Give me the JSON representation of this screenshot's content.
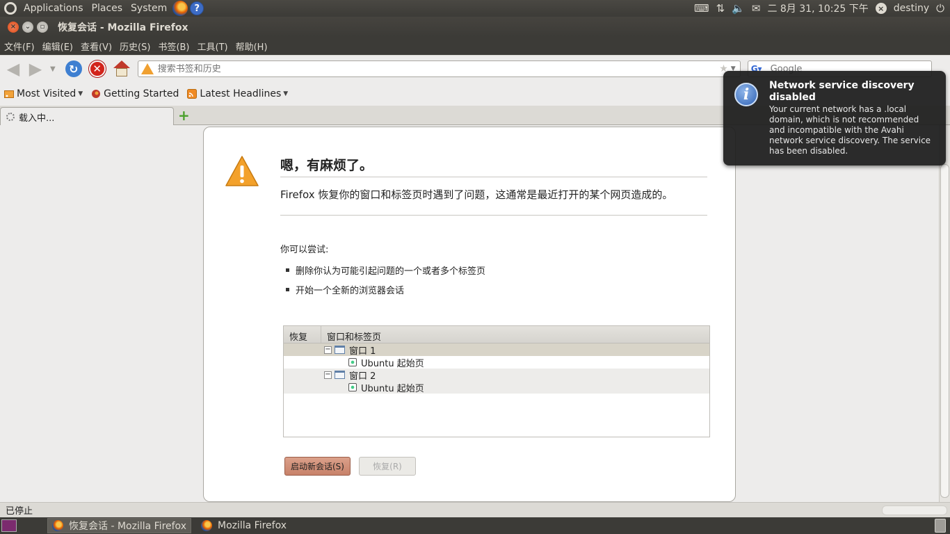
{
  "top_panel": {
    "menus": [
      "Applications",
      "Places",
      "System"
    ],
    "help_glyph": "?",
    "clock": "二 8月 31, 10:25 下午",
    "user": "destiny"
  },
  "window": {
    "title": "恢复会话 - Mozilla Firefox"
  },
  "menubar": {
    "items": [
      "文件(F)",
      "编辑(E)",
      "查看(V)",
      "历史(S)",
      "书签(B)",
      "工具(T)",
      "帮助(H)"
    ]
  },
  "navbar": {
    "url_placeholder": "搜索书签和历史",
    "search_placeholder": "Google"
  },
  "bookmarks": {
    "items": [
      "Most Visited",
      "Getting Started",
      "Latest Headlines"
    ]
  },
  "tabs": {
    "active_label": "载入中..."
  },
  "error_page": {
    "title": "嗯，有麻烦了。",
    "description": "Firefox 恢复你的窗口和标签页时遇到了问题，这通常是最近打开的某个网页造成的。",
    "try_label": "你可以尝试:",
    "suggestions": [
      "删除你认为可能引起问题的一个或者多个标签页",
      "开始一个全新的浏览器会话"
    ],
    "tree": {
      "col_restore": "恢复",
      "col_windows": "窗口和标签页",
      "rows": [
        {
          "label": "窗口 1",
          "type": "window",
          "toggle": "−"
        },
        {
          "label": "Ubuntu 起始页",
          "type": "page"
        },
        {
          "label": "窗口 2",
          "type": "window",
          "toggle": "−"
        },
        {
          "label": "Ubuntu 起始页",
          "type": "page"
        }
      ]
    },
    "btn_new_session": "启动新会话(S)",
    "btn_restore": "恢复(R)"
  },
  "statusbar": {
    "text": "已停止"
  },
  "taskbar": {
    "tasks": [
      "恢复会话 - Mozilla Firefox",
      "Mozilla Firefox"
    ]
  },
  "notification": {
    "title": "Network service discovery disabled",
    "body": "Your current network has a .local domain, which is not recommended and incompatible with the Avahi network service discovery. The service has been disabled."
  },
  "colors": {
    "panel": "#3c3b37",
    "accent_orange": "#dd4814",
    "primary_button": "#c8826a"
  }
}
